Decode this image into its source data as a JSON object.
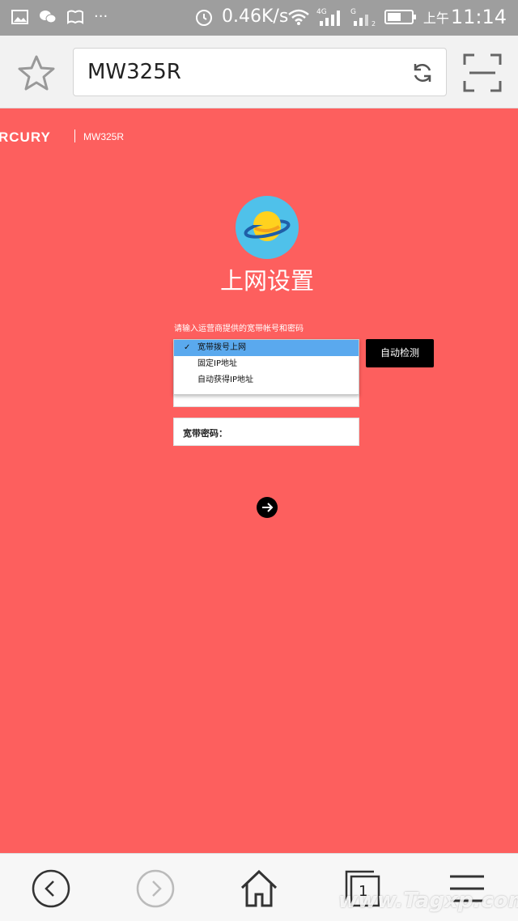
{
  "status_bar": {
    "speed": "0.46K/s",
    "network_4g": "4G",
    "network_g": "G",
    "sim2": "2",
    "time_prefix": "上午",
    "time": "11:14"
  },
  "browser": {
    "url": "MW325R"
  },
  "page": {
    "brand": "RCURY",
    "model": "MW325R",
    "title": "上网设置",
    "hint": "请输入运营商提供的宽带帐号和密码",
    "dropdown_options": [
      {
        "label": "宽带拨号上网",
        "selected": true
      },
      {
        "label": "固定IP地址",
        "selected": false
      },
      {
        "label": "自动获得IP地址",
        "selected": false
      }
    ],
    "check_mark": "✓",
    "detect_button": "自动检测",
    "password_label": "宽带密码："
  },
  "bottom_nav": {
    "tab_count": "1"
  },
  "watermark": "www.Tagxp.com"
}
